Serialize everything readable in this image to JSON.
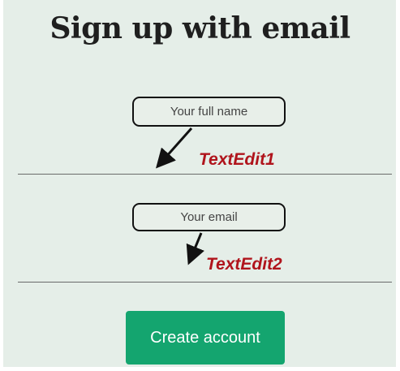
{
  "page": {
    "title": "Sign up with email"
  },
  "form": {
    "name_placeholder": "Your full name",
    "email_placeholder": "Your email",
    "submit_label": "Create account"
  },
  "annotations": {
    "name_label": "TextEdit1",
    "email_label": "TextEdit2"
  },
  "colors": {
    "background": "#e5eee8",
    "button": "#14a56f",
    "annotation": "#b0141c"
  }
}
